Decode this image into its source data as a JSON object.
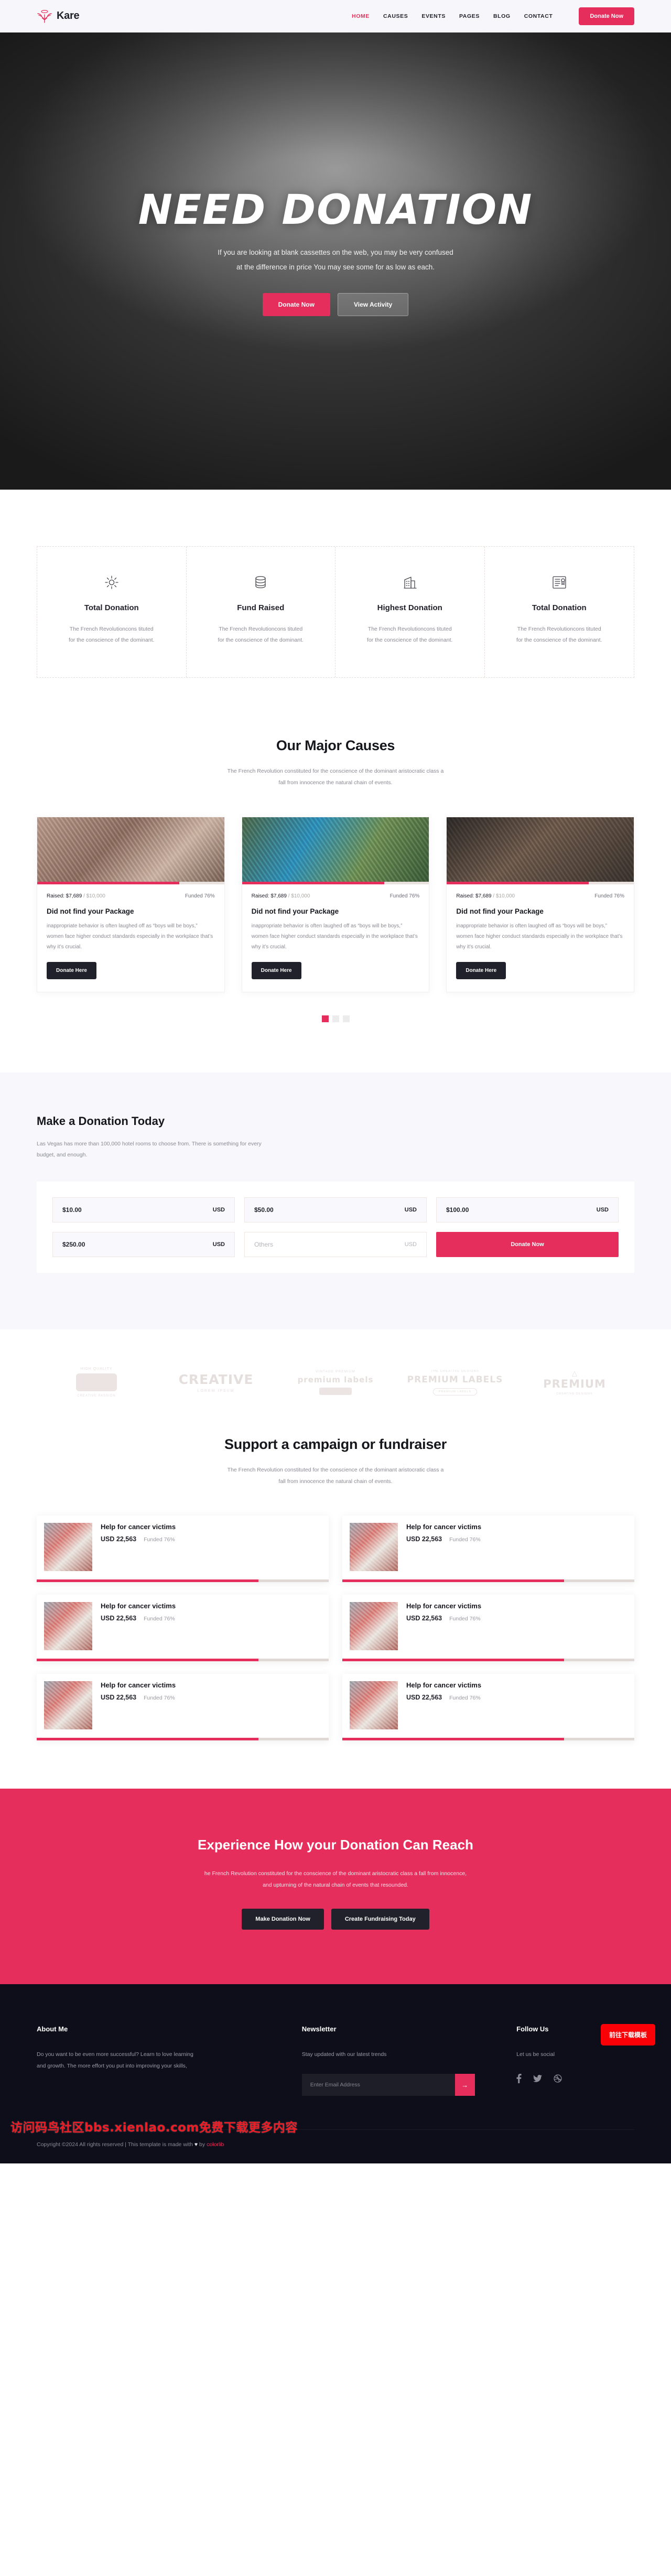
{
  "header": {
    "brand": "Kare",
    "nav": [
      {
        "label": "HOME",
        "active": true
      },
      {
        "label": "CAUSES",
        "active": false
      },
      {
        "label": "EVENTS",
        "active": false
      },
      {
        "label": "PAGES",
        "active": false
      },
      {
        "label": "BLOG",
        "active": false
      },
      {
        "label": "CONTACT",
        "active": false
      }
    ],
    "donate_label": "Donate Now",
    "accent": "#e62e5c"
  },
  "hero": {
    "title": "Need Donation",
    "sub_line1": "If you are looking at blank cassettes on the web, you may be very confused",
    "sub_line2": "at the difference in price You may see some for as low as each.",
    "btn_primary": "Donate Now",
    "btn_secondary": "View Activity"
  },
  "features": [
    {
      "icon": "sun-icon",
      "title": "Total Donation",
      "line1": "The French Revolutioncons tituted",
      "line2": "for the conscience of the dominant."
    },
    {
      "icon": "database-icon",
      "title": "Fund Raised",
      "line1": "The French Revolutioncons tituted",
      "line2": "for the conscience of the dominant."
    },
    {
      "icon": "building-icon",
      "title": "Highest Donation",
      "line1": "The French Revolutioncons tituted",
      "line2": "for the conscience of the dominant."
    },
    {
      "icon": "certificate-icon",
      "title": "Total Donation",
      "line1": "The French Revolutioncons tituted",
      "line2": "for the conscience of the dominant."
    }
  ],
  "causes_section": {
    "title": "Our Major Causes",
    "sub_line1": "The French Revolution constituted for the conscience of the dominant aristocratic class a",
    "sub_line2": "fall from innocence the natural chain of events.",
    "cards": [
      {
        "raised_label": "Raised: $7,689",
        "goal_label": "/ $10,000",
        "funded": "Funded 76%",
        "percent": 76,
        "title": "Did not find your Package",
        "text": "inappropriate behavior is often laughed off as “boys will be boys,” women face higher conduct standards especially in the workplace that’s why it’s crucial.",
        "btn": "Donate Here"
      },
      {
        "raised_label": "Raised: $7,689",
        "goal_label": "/ $10,000",
        "funded": "Funded 76%",
        "percent": 76,
        "title": "Did not find your Package",
        "text": "inappropriate behavior is often laughed off as “boys will be boys,” women face higher conduct standards especially in the workplace that’s why it’s crucial.",
        "btn": "Donate Here"
      },
      {
        "raised_label": "Raised: $7,689",
        "goal_label": "/ $10,000",
        "funded": "Funded 76%",
        "percent": 76,
        "title": "Did not find your Package",
        "text": "inappropriate behavior is often laughed off as “boys will be boys,” women face higher conduct standards especially in the workplace that’s why it’s crucial.",
        "btn": "Donate Here"
      }
    ],
    "dots": 3,
    "active_dot": 0
  },
  "donate": {
    "title": "Make a Donation Today",
    "sub_line1": "Las Vegas has more than 100,000 hotel rooms to choose from. There is something for",
    "sub_line2": "every budget, and enough.",
    "amounts": [
      {
        "value": "$10.00",
        "currency": "USD",
        "blank": false
      },
      {
        "value": "$50.00",
        "currency": "USD",
        "blank": false
      },
      {
        "value": "$100.00",
        "currency": "USD",
        "blank": false
      },
      {
        "value": "$250.00",
        "currency": "USD",
        "blank": false
      },
      {
        "value": "Others",
        "currency": "USD",
        "blank": true
      }
    ],
    "submit": "Donate Now"
  },
  "brands": [
    {
      "top": "HIGH QUALITY",
      "main": "",
      "bottom": "CREATIVE PASSION"
    },
    {
      "top": "",
      "main": "CREATIVE",
      "bottom": "LOREM IPSUM"
    },
    {
      "top": "VINTAGE PREMIUM",
      "main": "premium labels",
      "bottom": ""
    },
    {
      "top": "THE CREATIVE DESIGNS",
      "main": "PREMIUM LABELS",
      "bottom": "PREMIUM LABELS"
    },
    {
      "top": "",
      "main": "PREMIUM",
      "bottom": "CREATIVE DESIGNS"
    }
  ],
  "campaigns_section": {
    "title": "Support a campaign or fundraiser",
    "sub_line1": "The French Revolution constituted for the conscience of the dominant aristocratic class a",
    "sub_line2": "fall from innocence the natural chain of events.",
    "cards": [
      {
        "title": "Help for cancer victims",
        "amount": "USD 22,563",
        "funded": "Funded 76%",
        "percent": 76
      },
      {
        "title": "Help for cancer victims",
        "amount": "USD 22,563",
        "funded": "Funded 76%",
        "percent": 76
      },
      {
        "title": "Help for cancer victims",
        "amount": "USD 22,563",
        "funded": "Funded 76%",
        "percent": 76
      },
      {
        "title": "Help for cancer victims",
        "amount": "USD 22,563",
        "funded": "Funded 76%",
        "percent": 76
      },
      {
        "title": "Help for cancer victims",
        "amount": "USD 22,563",
        "funded": "Funded 76%",
        "percent": 76
      },
      {
        "title": "Help for cancer victims",
        "amount": "USD 22,563",
        "funded": "Funded 76%",
        "percent": 76
      }
    ]
  },
  "cta": {
    "title": "Experience How your Donation Can Reach",
    "sub_line1": "he French Revolution constituted for the conscience of the dominant aristocratic class a fall from innocence,",
    "sub_line2": "and upturning of the natural chain of events that resounded.",
    "btn1": "Make Donation Now",
    "btn2": "Create Fundraising Today",
    "bg": "#e62e5c"
  },
  "footer": {
    "about_title": "About Me",
    "about_line1": "Do you want to be even more successful? Learn to love learning",
    "about_line2": "and growth. The more effort you put into improving your skills,",
    "news_title": "Newsletter",
    "news_sub": "Stay updated with our latest trends",
    "news_placeholder": "Enter Email Address",
    "follow_title": "Follow Us",
    "follow_sub": "Let us be social",
    "socials": [
      "facebook-icon",
      "twitter-icon",
      "dribbble-icon"
    ],
    "copyright_pre": "Copyright ©2024 All rights reserved | This template is made with ",
    "copyright_heart": "♥",
    "copyright_mid": " by ",
    "copyright_brand": "colorlib"
  },
  "overlays": {
    "watermark": "访问码鸟社区bbs.xienlao.com免费下载更多内容",
    "download_btn": "前往下载模板"
  }
}
